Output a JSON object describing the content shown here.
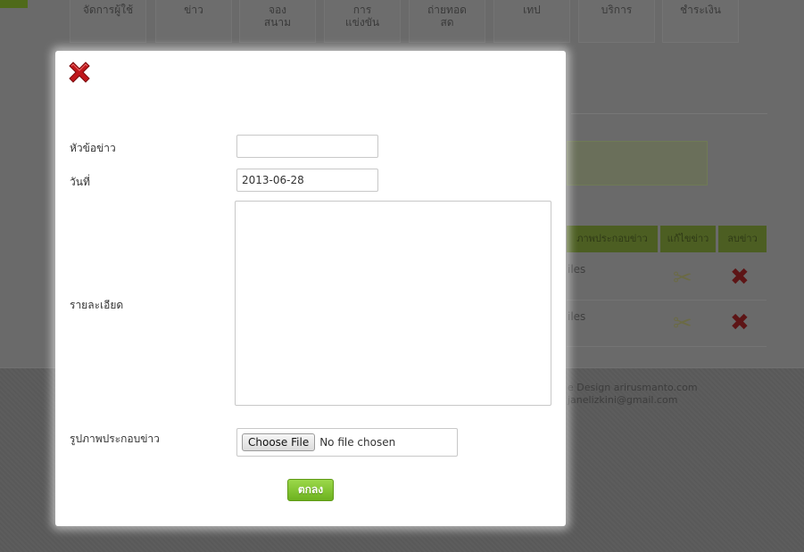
{
  "background": {
    "nav": [
      "จัดการผู้ใช้",
      "ข่าว",
      "จองสนาม",
      "การแข่งขัน",
      "ถ่ายทอดสด",
      "เทป",
      "บริการ",
      "ชำระเงิน"
    ],
    "table_headers": [
      "ภาพประกอบข่าว",
      "แก้ไขข่าว",
      "ลบข่าว"
    ],
    "rows": [
      {
        "image_text": "iles"
      },
      {
        "image_text": "iles"
      }
    ],
    "footer_lines": [
      "e Design arirusmanto.com",
      "janelizkini@gmail.com"
    ]
  },
  "modal": {
    "close_icon": "close-x-icon",
    "fields": {
      "title_label": "หัวข้อข่าว",
      "title_value": "",
      "date_label": "วันที่",
      "date_value": "2013-06-28",
      "detail_label": "รายละเอียด",
      "detail_value": "",
      "image_label": "รูปภาพประกอบข่าว",
      "file_button": "Choose File",
      "file_status": "No file chosen"
    },
    "submit_label": "ตกลง"
  },
  "colors": {
    "accent_green": "#7cc22a",
    "close_red": "#c0171b"
  }
}
